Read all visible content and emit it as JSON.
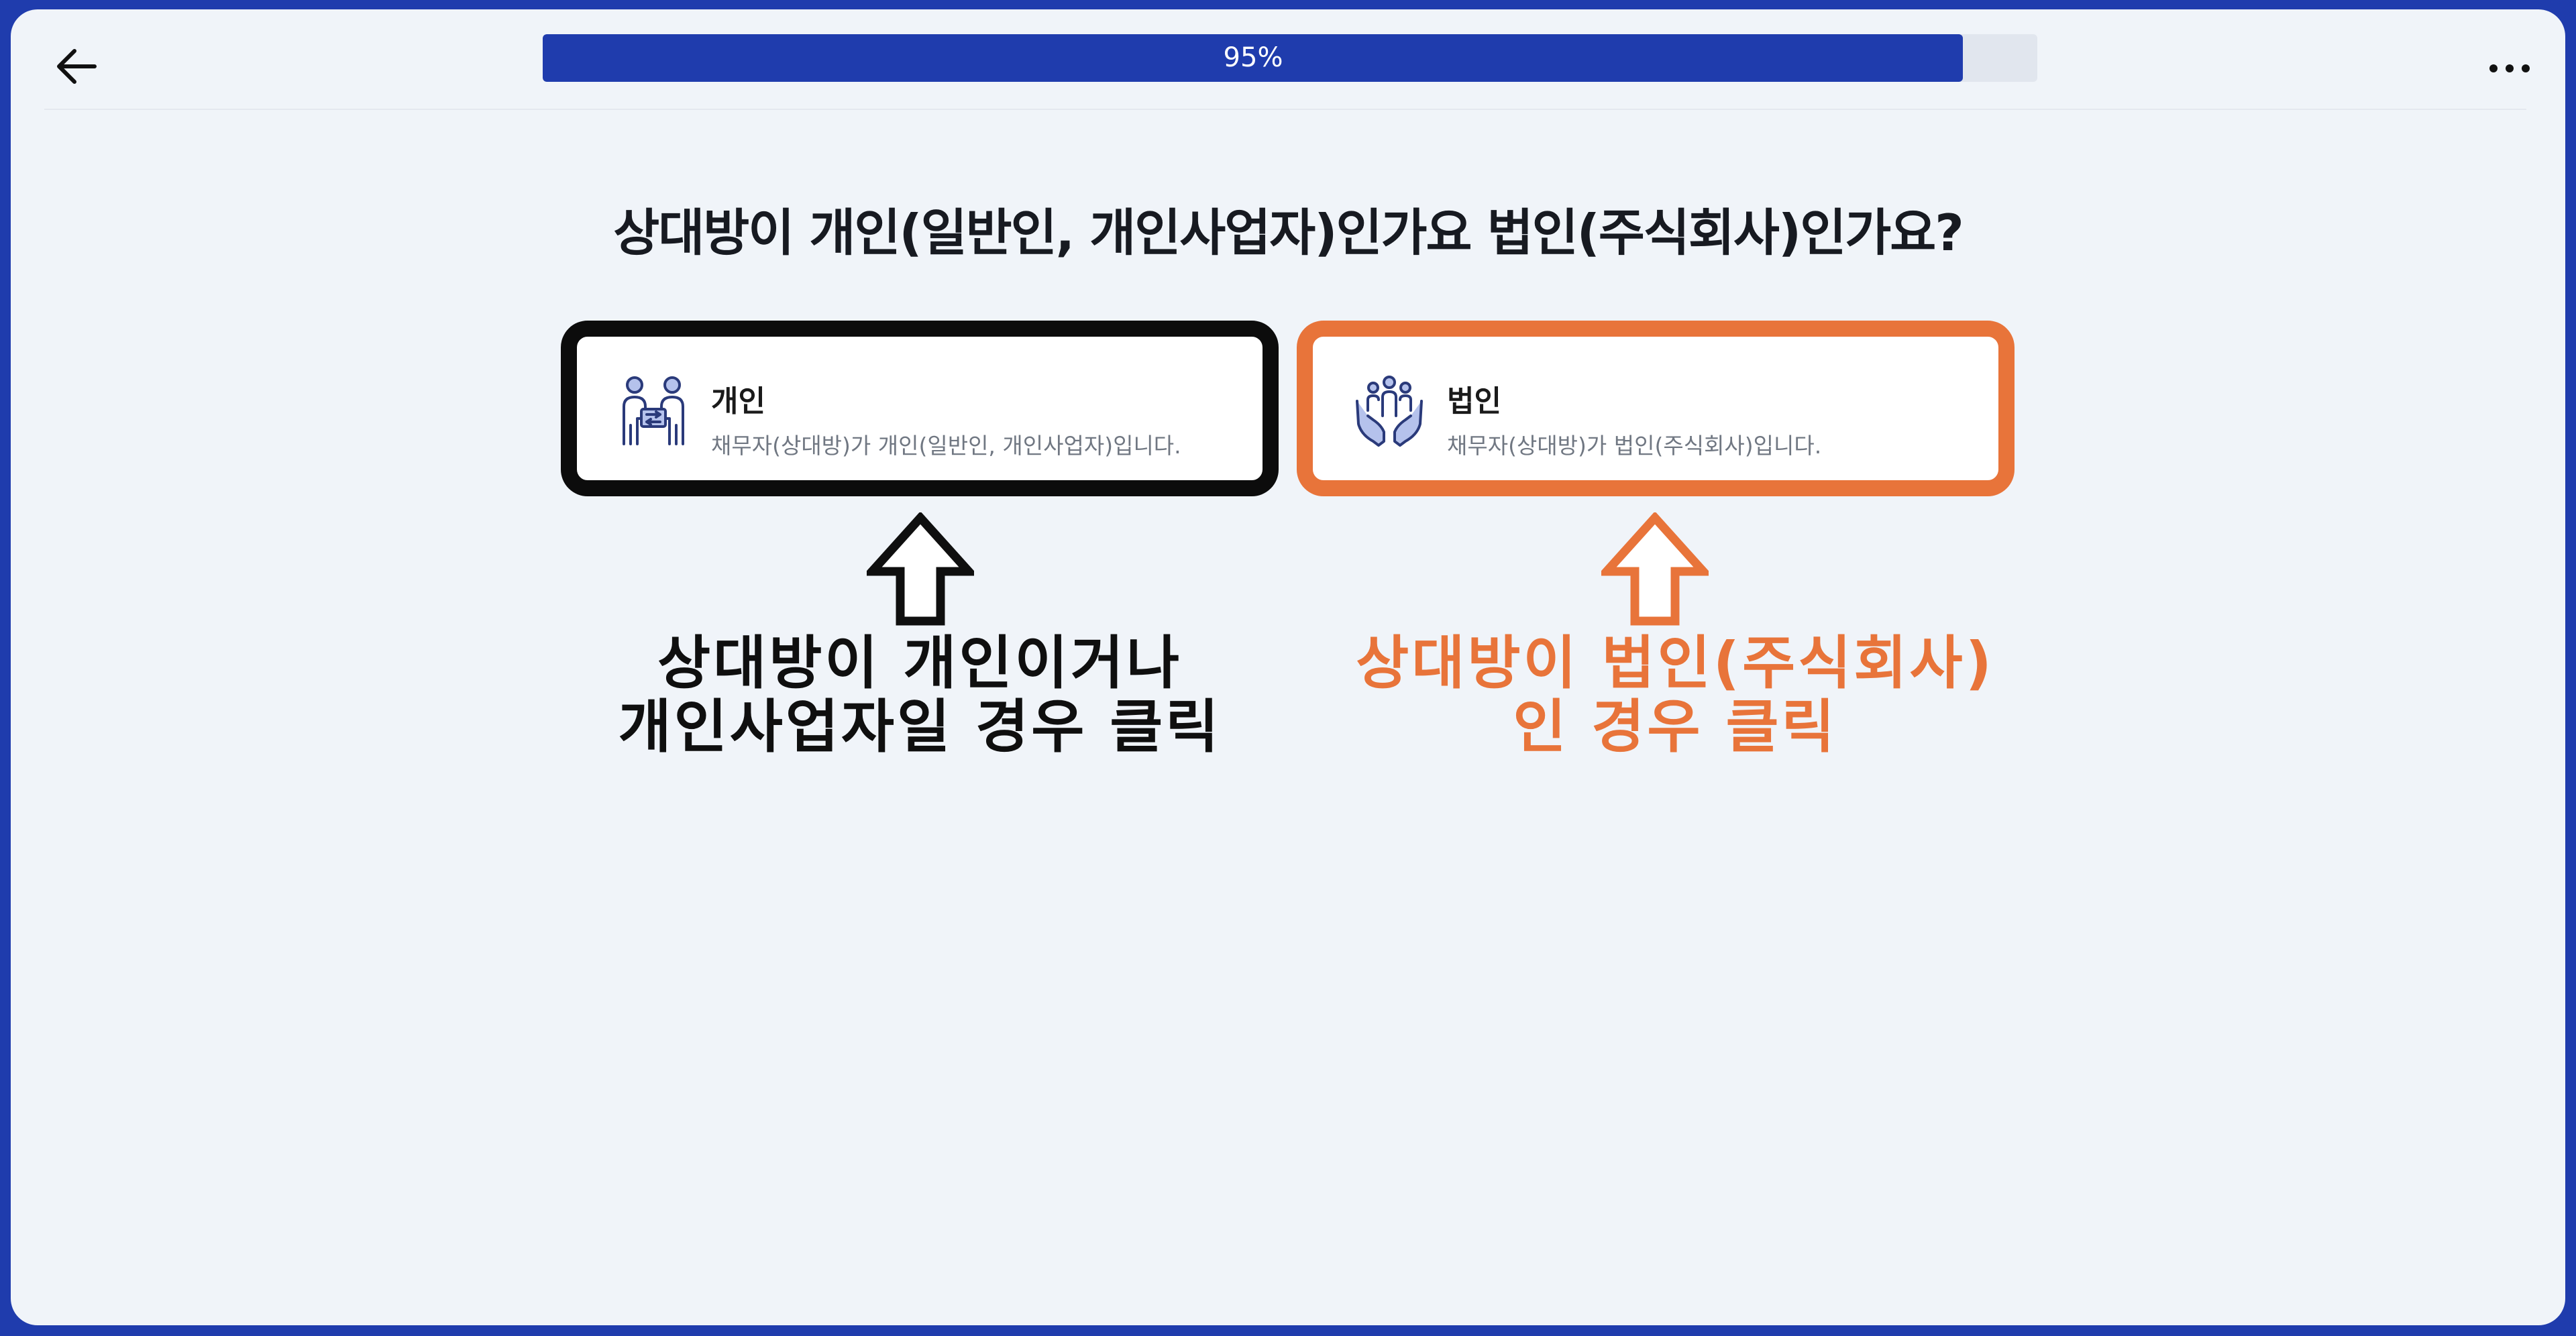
{
  "header": {
    "progress_label": "95%",
    "progress_value": 0.95
  },
  "question": "상대방이 개인(일반인, 개인사업자)인가요 법인(주식회사)인가요?",
  "options": [
    {
      "title": "개인",
      "description": "채무자(상대방)가 개인(일반인, 개인사업자)입니다.",
      "icon": "people-exchange-icon"
    },
    {
      "title": "법인",
      "description": "채무자(상대방)가 법인(주식회사)입니다.",
      "icon": "hands-group-icon"
    }
  ],
  "annotations": {
    "individual": [
      "상대방이 개인이거나",
      "개인사업자일 경우 클릭"
    ],
    "corporate": [
      "상대방이 법인(주식회사)",
      "인 경우 클릭"
    ]
  },
  "colors": {
    "brand": "#1f3cad",
    "individual_highlight": "#0c0c0c",
    "corporate_highlight": "#e8743a",
    "icon_fill": "#b5c2ec",
    "icon_stroke": "#2a3a7a"
  }
}
